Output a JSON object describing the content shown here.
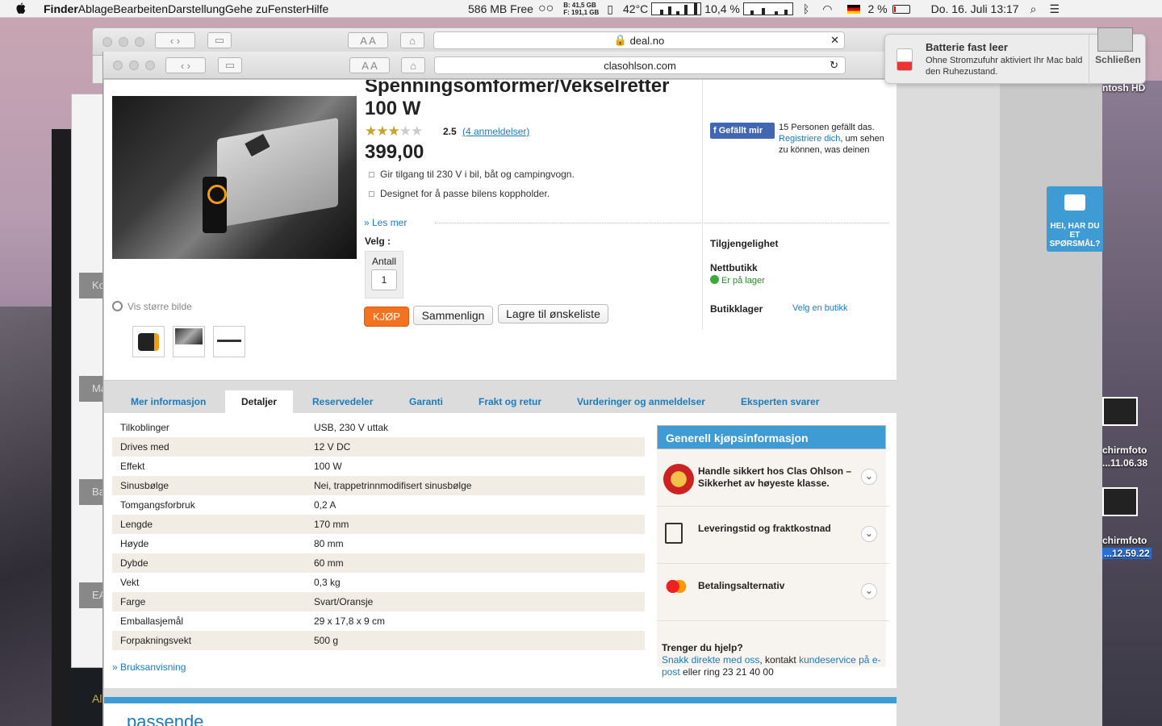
{
  "menubar": {
    "app": "Finder",
    "items": [
      "Ablage",
      "Bearbeiten",
      "Darstellung",
      "Gehe zu",
      "Fenster",
      "Hilfe"
    ],
    "mem": "586 MB Free",
    "disk_b": "B: 41,5 GB",
    "disk_f": "F: 191,1 GB",
    "temp": "42°C",
    "cpu": "10,4 %",
    "battery": "2 %",
    "datetime": "Do. 16. Juli 13:17"
  },
  "windows": {
    "back_url": "deal.no",
    "front_url": "clasohlson.com"
  },
  "bg_labels": {
    "l1": "Ko",
    "l2": "Ma",
    "l3": "Ba",
    "l4": "EA",
    "foot": "Al"
  },
  "notification": {
    "title": "Batterie fast leer",
    "text": "Ohne Stromzufuhr aktiviert Ihr Mac bald den Ruhezustand.",
    "close": "Schließen"
  },
  "desktop": {
    "hd": "ntosh HD",
    "shot1a": "chirmfoto",
    "shot1b": "...11.06.38",
    "shot2a": "chirmfoto",
    "shot2b": "...12.59.22"
  },
  "product": {
    "title1": "Spenningsomformer/Vekselretter",
    "title2": "100 W",
    "rating": "2.5",
    "reviews": "(4 anmeldelser)",
    "price": "399,00",
    "bullets": [
      "Gir tilgang til 230 V i bil, båt og campingvogn.",
      "Designet for å passe bilens koppholder."
    ],
    "les_mer": "» Les mer",
    "velg": "Velg :",
    "antall": "Antall",
    "qty": "1",
    "buy": "KJØP",
    "compare": "Sammenlign",
    "wishlist": "Lagre til ønskeliste",
    "vis_storre": "Vis større bilde"
  },
  "facebook": {
    "button": "Gefällt mir",
    "count_text": "15 Personen gefällt das.",
    "register": "Registriere dich",
    "rest": ", um sehen zu können, was deinen"
  },
  "availability": {
    "heading": "Tilgjengelighet",
    "nett": "Nettbutikk",
    "instock": "Er på lager",
    "store": "Butikklager",
    "choose_store": "Velg en butikk"
  },
  "tabs": [
    "Mer informasjon",
    "Detaljer",
    "Reservedeler",
    "Garanti",
    "Frakt og retur",
    "Vurderinger og anmeldelser",
    "Eksperten svarer"
  ],
  "specs": [
    [
      "Tilkoblinger",
      "USB, 230 V uttak"
    ],
    [
      "Drives med",
      "12 V DC"
    ],
    [
      "Effekt",
      "100 W"
    ],
    [
      "Sinusbølge",
      "Nei, trappetrinnmodifisert sinusbølge"
    ],
    [
      "Tomgangsforbruk",
      "0,2 A"
    ],
    [
      "Lengde",
      "170 mm"
    ],
    [
      "Høyde",
      "80 mm"
    ],
    [
      "Dybde",
      "60 mm"
    ],
    [
      "Vekt",
      "0,3 kg"
    ],
    [
      "Farge",
      "Svart/Oransje"
    ],
    [
      "Emballasjemål",
      "29 x 17,8 x 9 cm"
    ],
    [
      "Forpakningsvekt",
      "500  g"
    ]
  ],
  "bruksanvisning": "» Bruksanvisning",
  "sidebar": {
    "head": "Generell kjøpsinformasjon",
    "item1": "Handle sikkert hos Clas Ohlson – Sikkerhet av høyeste klasse.",
    "item2": "Leveringstid og fraktkostnad",
    "item3": "Betalingsalternativ",
    "help_title": "Trenger du hjelp?",
    "help_link1": "Snakk direkte med oss",
    "help_mid": ", kontakt ",
    "help_link2": "kundeservice på e-post",
    "help_end": " eller ring 23 21 40 00"
  },
  "chat": "HEI, HAR DU ET SPØRSMÅL?",
  "bottom": "passende"
}
